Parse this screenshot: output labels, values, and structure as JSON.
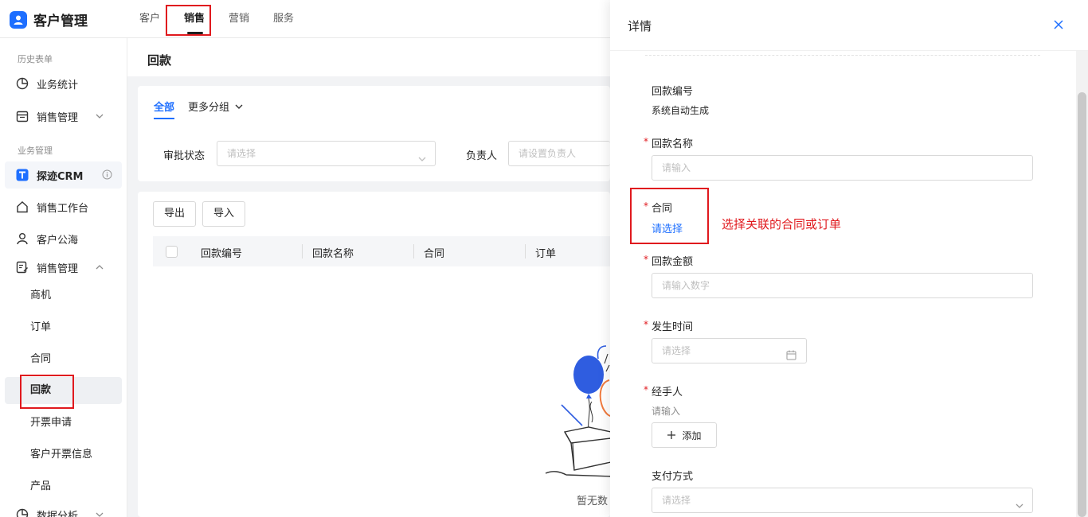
{
  "app": {
    "title": "客户管理"
  },
  "topnav": [
    {
      "label": "客户"
    },
    {
      "label": "销售"
    },
    {
      "label": "营销"
    },
    {
      "label": "服务"
    }
  ],
  "sidebar": {
    "group_history": "历史表单",
    "business_stats": "业务统计",
    "sales_management_top": "销售管理",
    "group_business": "业务管理",
    "crm": "探迹CRM",
    "sales_workbench": "销售工作台",
    "customer_pool": "客户公海",
    "sales_management": "销售管理",
    "sub_items": [
      "商机",
      "订单",
      "合同",
      "回款",
      "开票申请",
      "客户开票信息",
      "产品"
    ],
    "data_analysis": "数据分析"
  },
  "main": {
    "page_title": "回款",
    "tabs": {
      "all": "全部",
      "more_groups": "更多分组"
    },
    "filters": {
      "approval_status_label": "审批状态",
      "approval_status_placeholder": "请选择",
      "owner_label": "负责人",
      "owner_placeholder": "请设置负责人"
    },
    "buttons": {
      "export": "导出",
      "import": "导入"
    },
    "columns": [
      "回款编号",
      "回款名称",
      "合同",
      "订单"
    ],
    "empty_text": "暂无数"
  },
  "drawer": {
    "title": "详情",
    "fields": {
      "payment_number_label": "回款编号",
      "payment_number_value": "系统自动生成",
      "payment_name_label": "回款名称",
      "payment_name_placeholder": "请输入",
      "contract_label": "合同",
      "contract_select": "请选择",
      "amount_label": "回款金额",
      "amount_placeholder": "请输入数字",
      "date_label": "发生时间",
      "date_placeholder": "请选择",
      "handler_label": "经手人",
      "handler_hint": "请输入",
      "add_label": "添加",
      "payment_method_label": "支付方式",
      "payment_method_placeholder": "请选择"
    },
    "required_mark": "*",
    "annotation": "选择关联的合同或订单"
  }
}
